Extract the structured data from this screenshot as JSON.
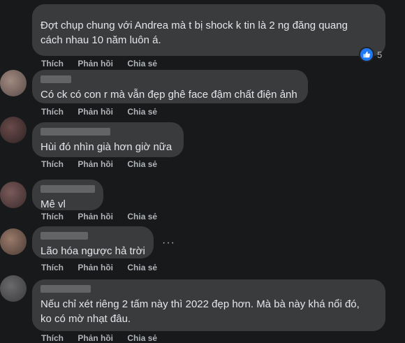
{
  "actions": {
    "like": "Thích",
    "reply": "Phản hồi",
    "share": "Chia sẻ"
  },
  "comments": [
    {
      "text": "Đợt chụp chung với Andrea mà t bị shock k tin là 2 ng đăng quang\ncách nhau 10 năm luôn á.",
      "reaction_icon": "like-icon",
      "reaction_count": "5"
    },
    {
      "text": "Có ck có con r mà vẫn đẹp ghê face đậm chất điện ảnh"
    },
    {
      "text": "Hùi đó nhìn già hơn giờ nữa"
    },
    {
      "text": "Mê vl"
    },
    {
      "text": "Lão hóa ngược hả trời",
      "more": "···"
    },
    {
      "text": "Nếu chỉ xét riêng 2 tấm này thì 2022 đẹp hơn. Mà bà này khá nổi đó,\nko có mờ nhạt đâu."
    }
  ],
  "colors": {
    "background": "#18191a",
    "bubble": "#3a3b3c",
    "text": "#e4e6eb",
    "secondary": "#b0b3b8",
    "like_blue": "#2078f4"
  }
}
